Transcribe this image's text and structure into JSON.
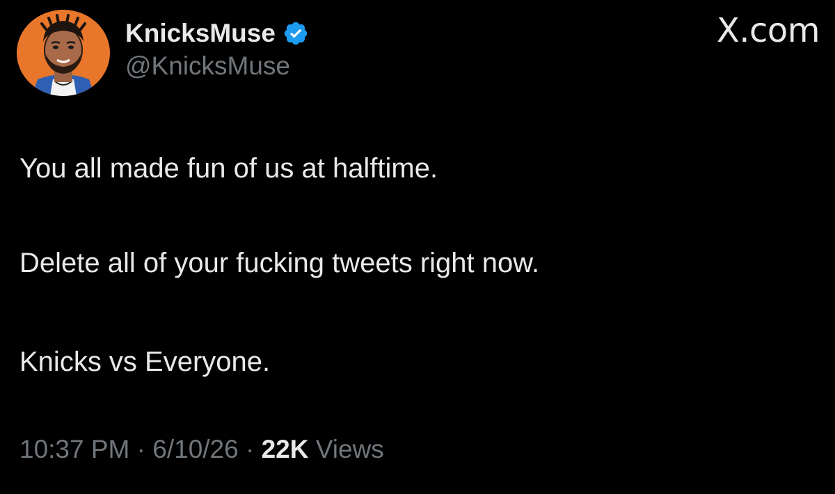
{
  "header": {
    "display_name": "KnicksMuse",
    "handle": "@KnicksMuse",
    "verified_icon": "verified-badge-icon",
    "avatar_icon": "cartoon-player-avatar",
    "brand": "X.com"
  },
  "tweet": {
    "paragraphs": [
      "You all made fun of us at halftime.",
      "Delete all of your fucking tweets right now.",
      "Knicks vs Everyone."
    ]
  },
  "meta": {
    "time": "10:37 PM",
    "separator_1": "·",
    "date": "6/10/26",
    "separator_2": "·",
    "views_count": "22K",
    "views_label": "Views"
  },
  "colors": {
    "background": "#000000",
    "text_primary": "#e7e9ea",
    "text_secondary": "#71767b",
    "verified_blue": "#1d9bf0",
    "avatar_bg": "#e9772b"
  }
}
